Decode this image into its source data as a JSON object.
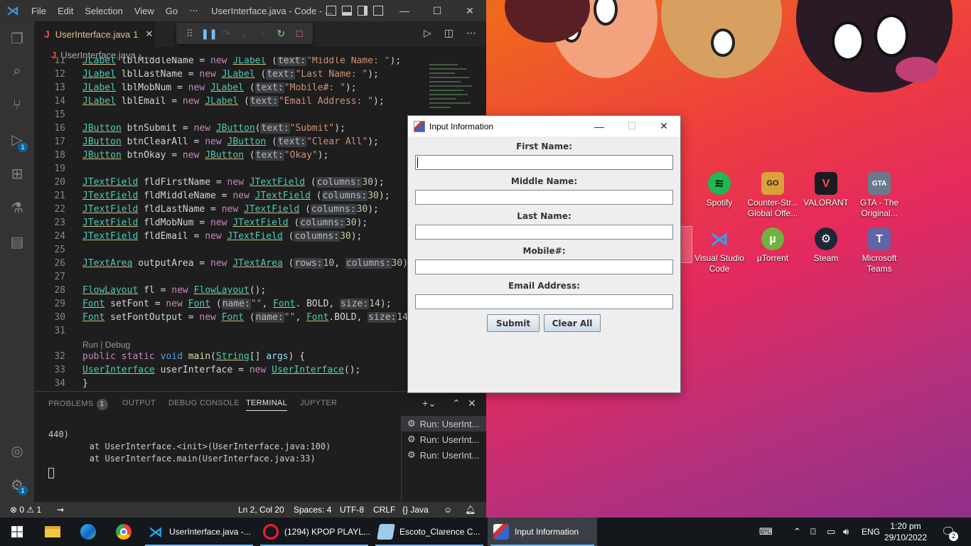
{
  "vscode": {
    "menu": [
      "File",
      "Edit",
      "Selection",
      "View",
      "Go",
      "⋯"
    ],
    "window_title": "UserInterface.java - Code - ...",
    "tab": {
      "label": "UserInterface.java",
      "problems": "1"
    },
    "breadcrumb": "UserInterface.java",
    "breadcrumb_more": "...",
    "activity_badges": {
      "debug": "1",
      "settings": "1"
    },
    "code_lines": [
      {
        "num": "11",
        "text": "JLabel lblMiddleName = new JLabel (text:\"Middle Name: \");"
      },
      {
        "num": "12",
        "text": "JLabel lblLastName = new JLabel (text:\"Last Name: \");"
      },
      {
        "num": "13",
        "text": "JLabel lblMobNum = new JLabel (text:\"Mobile#: \");"
      },
      {
        "num": "14",
        "text": "JLabel lblEmail = new JLabel (text:\"Email Address: \");"
      },
      {
        "num": "15",
        "text": ""
      },
      {
        "num": "16",
        "text": "JButton btnSubmit = new JButton(text:\"Submit\");"
      },
      {
        "num": "17",
        "text": "JButton btnClearAll = new JButton (text:\"Clear All\");"
      },
      {
        "num": "18",
        "text": "JButton btnOkay = new JButton (text:\"Okay\");"
      },
      {
        "num": "19",
        "text": ""
      },
      {
        "num": "20",
        "text": "JTextField fldFirstName = new JTextField (columns:30);"
      },
      {
        "num": "21",
        "text": "JTextField fldMiddleName = new JTextField (columns:30);"
      },
      {
        "num": "22",
        "text": "JTextField fldLastName = new JTextField (columns:30);"
      },
      {
        "num": "23",
        "text": "JTextField fldMobNum = new JTextField (columns:30);"
      },
      {
        "num": "24",
        "text": "JTextField fldEmail = new JTextField (columns:30);"
      },
      {
        "num": "25",
        "text": ""
      },
      {
        "num": "26",
        "text": "JTextArea outputArea = new JTextArea (rows:10, columns:30);"
      },
      {
        "num": "27",
        "text": ""
      },
      {
        "num": "28",
        "text": "FlowLayout fl = new FlowLayout();"
      },
      {
        "num": "29",
        "text": "Font setFont = new Font (name:\"\", Font. BOLD, size:14);"
      },
      {
        "num": "30",
        "text": "Font setFontOutput = new Font (name:\"\", Font.BOLD, size:14"
      },
      {
        "num": "31",
        "text": ""
      },
      {
        "num": "32",
        "text": "public static void main(String[] args) {"
      },
      {
        "num": "33",
        "text": "UserInterface userInterface = new UserInterface();"
      },
      {
        "num": "34",
        "text": "}"
      }
    ],
    "codelens": "Run | Debug",
    "panel_tabs": [
      "PROBLEMS",
      "OUTPUT",
      "DEBUG CONSOLE",
      "TERMINAL",
      "JUPYTER"
    ],
    "problems_count": "1",
    "terminal_lines": [
      "440)",
      "        at UserInterface.<init>(UserInterface.java:100)",
      "        at UserInterface.main(UserInterface.java:33)"
    ],
    "terminal_sessions": [
      "Run: UserInt...",
      "Run: UserInt...",
      "Run: UserInt..."
    ],
    "status": {
      "errors": "0",
      "warnings": "1",
      "position": "Ln 2, Col 20",
      "spaces": "Spaces: 4",
      "encoding": "UTF-8",
      "eol": "CRLF",
      "language": "Java"
    }
  },
  "dialog": {
    "title": "Input Information",
    "fields": [
      {
        "label": "First Name:",
        "value": ""
      },
      {
        "label": "Middle Name:",
        "value": ""
      },
      {
        "label": "Last Name:",
        "value": ""
      },
      {
        "label": "Mobile#:",
        "value": ""
      },
      {
        "label": "Email Address:",
        "value": ""
      }
    ],
    "submit_label": "Submit",
    "clear_label": "Clear All"
  },
  "desktop_icons": [
    {
      "label": "Spotify",
      "icon": "spotify-icon",
      "color": "#1db954"
    },
    {
      "label": "Counter-Str... Global Offe...",
      "icon": "csgo-icon",
      "color": "#d9a23a"
    },
    {
      "label": "VALORANT",
      "icon": "valorant-icon",
      "color": "#ff4655"
    },
    {
      "label": "GTA - The Original...",
      "icon": "gta-icon",
      "color": "#6a7a8a"
    },
    {
      "label": "Visual Studio Code",
      "icon": "vscode-icon",
      "color": "#23a9f2"
    },
    {
      "label": "µTorrent",
      "icon": "utorrent-icon",
      "color": "#6fb33f"
    },
    {
      "label": "Steam",
      "icon": "steam-icon",
      "color": "#1b2838"
    },
    {
      "label": "Microsoft Teams",
      "icon": "teams-icon",
      "color": "#6264a7"
    }
  ],
  "taskbar": {
    "apps": [
      {
        "label": "UserInterface.java -...",
        "icon": "vscode-icon"
      },
      {
        "label": "(1294) KPOP PLAYL...",
        "icon": "opera-icon"
      },
      {
        "label": "Escoto_Clarence C...",
        "icon": "notepad-icon"
      },
      {
        "label": "Input Information",
        "icon": "java-icon"
      }
    ],
    "language": "ENG",
    "time": "1:20 pm",
    "date": "29/10/2022",
    "notifications": "2"
  },
  "colors": {
    "accent": "#0e639c",
    "terminal_bg": "#1e1e1e",
    "dialog_bg": "#eeeeee"
  }
}
